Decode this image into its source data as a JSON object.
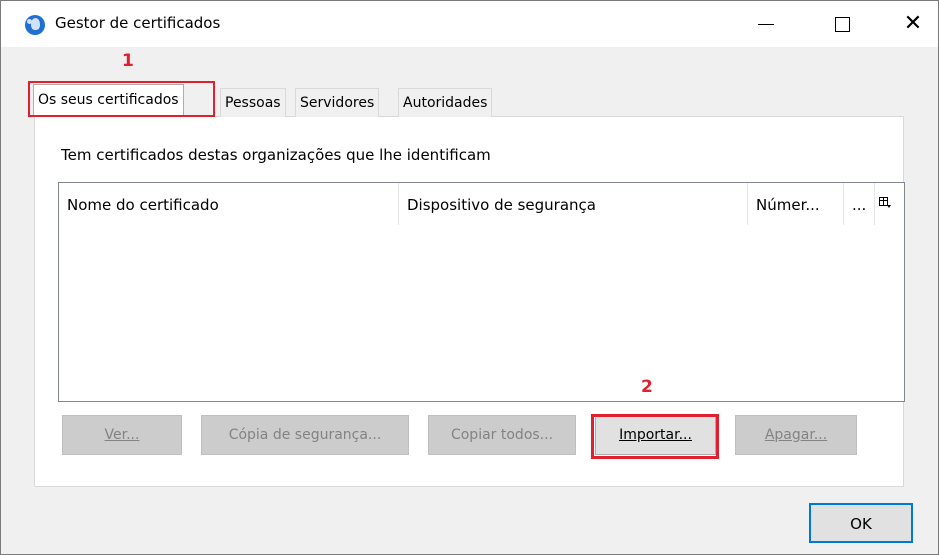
{
  "window": {
    "title": "Gestor de certificados",
    "controls": {
      "minimize": "—",
      "maximize": "☐",
      "close": "✕"
    }
  },
  "annotations": {
    "marker1": "1",
    "marker2": "2",
    "color": "#e0202e"
  },
  "tabs": [
    {
      "label": "Os seus certificados",
      "active": true
    },
    {
      "label": "Pessoas",
      "active": false
    },
    {
      "label": "Servidores",
      "active": false
    },
    {
      "label": "Autoridades",
      "active": false
    }
  ],
  "panel": {
    "intro": "Tem certificados destas organizações que lhe identificam",
    "columns": [
      "Nome do certificado",
      "Dispositivo de segurança",
      "Númer...",
      "...",
      "column-picker-icon"
    ],
    "rows": []
  },
  "buttons": {
    "ver": {
      "label": "Ver...",
      "enabled": false
    },
    "copia": {
      "label": "Cópia de segurança...",
      "enabled": false
    },
    "copiar_todos": {
      "label": "Copiar todos...",
      "enabled": false
    },
    "importar": {
      "label": "Importar...",
      "enabled": true
    },
    "apagar": {
      "label": "Apagar...",
      "enabled": false
    }
  },
  "footer": {
    "ok": "OK",
    "accent": "#0078d7"
  }
}
